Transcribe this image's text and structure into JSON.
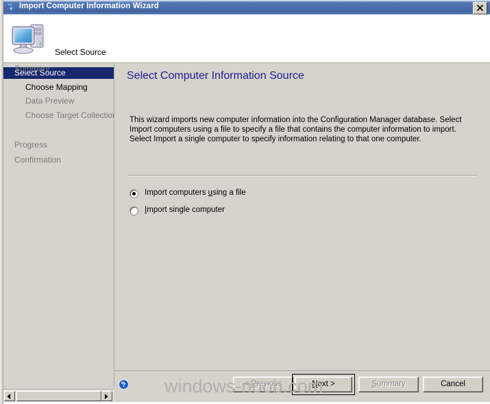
{
  "window": {
    "title": "Import Computer Information Wizard",
    "title_icon": "import-arrow-icon",
    "close_label": "Close",
    "titlebar_color": "#4a6dab",
    "face_color": "#d6d3cd"
  },
  "header": {
    "icon": "computer-icon",
    "title": "Select Source"
  },
  "sidebar": {
    "selected_color": "#16286e",
    "items": [
      {
        "label": "Select Source",
        "state": "selected",
        "indent": false
      },
      {
        "label": "Choose Mapping",
        "state": "next",
        "indent": true
      },
      {
        "label": "Data Preview",
        "state": "pending",
        "indent": true
      },
      {
        "label": "Choose Target Collection",
        "state": "pending",
        "indent": true
      },
      {
        "label": "Summary",
        "state": "pending",
        "indent": false
      },
      {
        "label": "Progress",
        "state": "pending",
        "indent": false
      },
      {
        "label": "Confirmation",
        "state": "pending",
        "indent": false
      }
    ]
  },
  "content": {
    "heading": "Select Computer Information Source",
    "heading_color": "#1b1b8f",
    "body_text": "This wizard imports new computer information into the Configuration Manager database. Select Import computers using a file to specify a file that contains the computer information to import. Select Import a single computer to specify information relating to that one computer.",
    "options": [
      {
        "label_before": "Import computers ",
        "accelerator": "u",
        "label_after": "sing a file",
        "selected": true
      },
      {
        "label_before": "",
        "accelerator": "I",
        "label_after": "mport single computer",
        "selected": false
      }
    ]
  },
  "footer": {
    "help_icon": "help-question-icon",
    "buttons": [
      {
        "label_before": "< ",
        "accelerator": "P",
        "label_after": "revious",
        "enabled": false
      },
      {
        "label_before": "",
        "accelerator": "N",
        "label_after": "ext >",
        "enabled": true,
        "default": true
      },
      {
        "label_before": "",
        "accelerator": "S",
        "label_after": "ummary",
        "enabled": false
      },
      {
        "label_before": "Cancel",
        "accelerator": "",
        "label_after": "",
        "enabled": true
      }
    ]
  },
  "watermark": {
    "text": "windows-noob.com"
  },
  "scrollbar": {
    "left_arrow": "scroll-left-icon",
    "right_arrow": "scroll-right-icon"
  }
}
